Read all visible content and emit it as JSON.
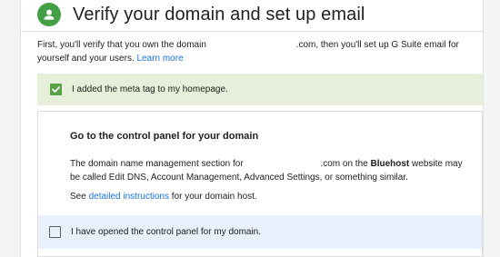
{
  "header": {
    "title": "Verify your domain and set up email",
    "icon": "person-icon",
    "icon_color": "#43a047"
  },
  "intro": {
    "text_before": "First, you'll verify that you own the domain",
    "domain_suffix": ".com",
    "text_after": ", then you'll set up G Suite email for yourself and your users.",
    "learn_more_label": "Learn more"
  },
  "meta_tag_step": {
    "label": "I added the meta tag to my homepage.",
    "checked": true,
    "background": "#e6efd9"
  },
  "control_panel": {
    "title": "Go to the control panel for your domain",
    "desc_before": "The domain name management section for",
    "domain_suffix": ".com on the ",
    "host_name": "Bluehost",
    "desc_after": " website may be called Edit DNS, Account Management, Advanced Settings, or something similar.",
    "see_prefix": "See ",
    "instructions_link": "detailed instructions",
    "see_suffix": " for your domain host.",
    "opened_label": "I have opened the control panel for my domain.",
    "opened_checked": false
  },
  "colors": {
    "link": "#1a73e8",
    "check_green": "#5aa247",
    "opened_bg": "#e8f1fb"
  }
}
